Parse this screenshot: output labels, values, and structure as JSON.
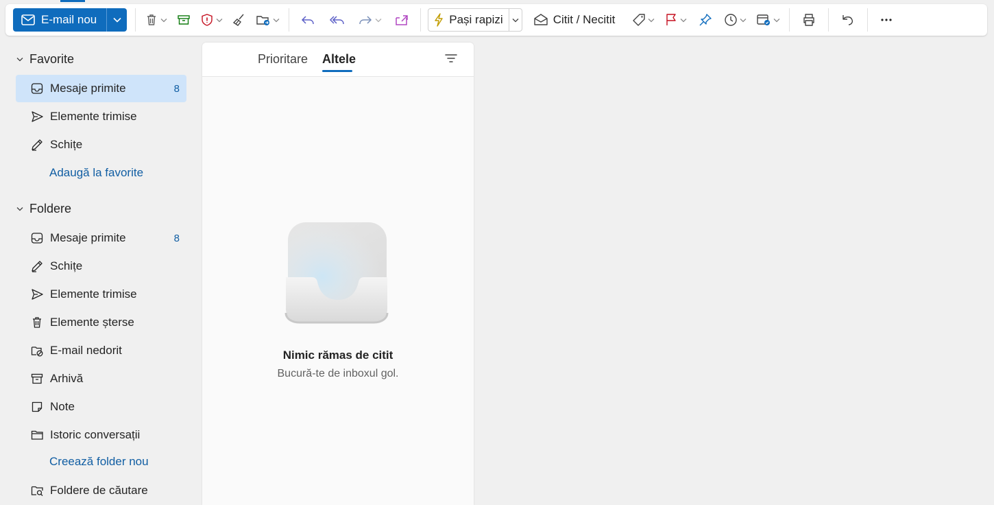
{
  "toolbar": {
    "new_mail_label": "E-mail nou",
    "quick_steps_label": "Pași rapizi",
    "read_unread_label": "Citit / Necitit",
    "icons": [
      "mail-icon",
      "chevron-down-icon",
      "delete-icon",
      "archive-icon",
      "report-icon",
      "sweep-icon",
      "move-to-icon",
      "reply-icon",
      "reply-all-icon",
      "forward-icon",
      "share-icon",
      "lightning-icon",
      "envelope-open-icon",
      "tag-icon",
      "flag-icon",
      "pin-icon",
      "snooze-icon",
      "rules-icon",
      "print-icon",
      "undo-icon",
      "more-icon"
    ]
  },
  "sidebar": {
    "favorites": {
      "title": "Favorite",
      "items": [
        {
          "label": "Mesaje primite",
          "count": "8",
          "icon": "inbox-icon"
        },
        {
          "label": "Elemente trimise",
          "count": "",
          "icon": "send-icon"
        },
        {
          "label": "Schițe",
          "count": "",
          "icon": "draft-icon"
        }
      ],
      "add_link": "Adaugă la favorite"
    },
    "folders": {
      "title": "Foldere",
      "items": [
        {
          "label": "Mesaje primite",
          "count": "8",
          "icon": "inbox-icon"
        },
        {
          "label": "Schițe",
          "count": "",
          "icon": "draft-icon"
        },
        {
          "label": "Elemente trimise",
          "count": "",
          "icon": "send-icon"
        },
        {
          "label": "Elemente șterse",
          "count": "",
          "icon": "delete-icon"
        },
        {
          "label": "E-mail nedorit",
          "count": "",
          "icon": "junk-icon"
        },
        {
          "label": "Arhivă",
          "count": "",
          "icon": "archive-icon"
        },
        {
          "label": "Note",
          "count": "",
          "icon": "note-icon"
        },
        {
          "label": "Istoric conversații",
          "count": "",
          "icon": "folder-icon"
        }
      ],
      "create_link": "Creează folder nou",
      "search_folders": "Foldere de căutare"
    }
  },
  "message_list": {
    "tabs": [
      "Prioritare",
      "Altele"
    ],
    "active_tab": "Altele",
    "empty_title": "Nimic rămas de citit",
    "empty_subtitle": "Bucură-te de inboxul gol."
  },
  "colors": {
    "accent": "#0f6cbd",
    "selected_bg": "#cfe4fa",
    "link": "#115ea3",
    "report_red": "#c50f1f",
    "share_purple": "#b146c2"
  }
}
